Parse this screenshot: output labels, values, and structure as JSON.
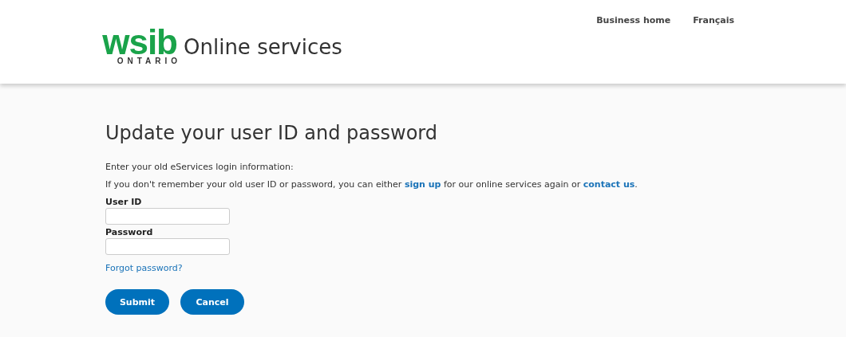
{
  "header": {
    "logo": {
      "wordmark": "wsib",
      "region": "ONTARIO"
    },
    "site_title": "Online services",
    "nav": [
      {
        "label": "Business home"
      },
      {
        "label": "Français"
      }
    ]
  },
  "page": {
    "heading": "Update your user ID and password",
    "intro": "Enter your old eServices login information:",
    "help": [
      {
        "kind": "text",
        "text": "If you don't remember your old user ID or password, you can either "
      },
      {
        "kind": "link",
        "text": "sign up"
      },
      {
        "kind": "text",
        "text": " for our online services again or "
      },
      {
        "kind": "link",
        "text": "contact us"
      },
      {
        "kind": "text",
        "text": "."
      }
    ],
    "fields": [
      {
        "label": "User ID"
      },
      {
        "label": "Password"
      }
    ],
    "forgot_link": "Forgot password?",
    "buttons": [
      "Submit",
      "Cancel"
    ]
  }
}
